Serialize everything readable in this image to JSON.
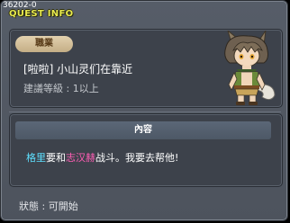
{
  "window": {
    "quest_id": "36202-0",
    "title": "QUEST INFO"
  },
  "header": {
    "job_label": "職業",
    "quest_name": "[啦啦] 小山灵们在靠近",
    "recommend_level": "建議等級 : 1以上"
  },
  "content": {
    "heading": "內容",
    "npc_1": "格里",
    "text_1": "要和",
    "npc_2": "志汉赫",
    "text_2": "战斗。我要去帮他!"
  },
  "status": {
    "text": "狀態 : 可開始"
  },
  "colors": {
    "title": "#e8ea4e",
    "npc_1": "#5ee0ff",
    "npc_2": "#ff5db4",
    "badge": "#d6c29c"
  },
  "icons": {
    "character": "npc-wolf-boy-portrait"
  }
}
